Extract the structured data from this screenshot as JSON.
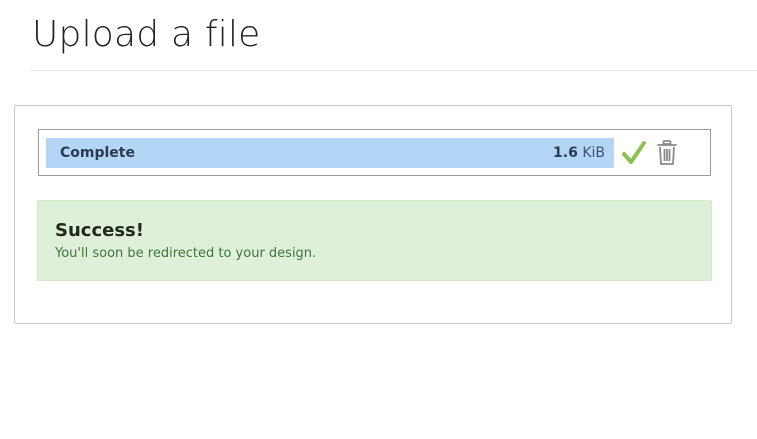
{
  "page": {
    "title": "Upload a file"
  },
  "upload": {
    "file": {
      "status": "Complete",
      "size_value": "1.6",
      "size_unit": "KiB",
      "progress_percent": 100,
      "status_icon": "checkmark-icon",
      "delete_icon": "trash-icon"
    }
  },
  "alert": {
    "title": "Success!",
    "message": "You'll soon be redirected to your design."
  },
  "colors": {
    "progress_fill": "#b3d6f7",
    "check": "#8cc152",
    "alert_background": "#dff0d8",
    "alert_text": "#3c763d"
  }
}
